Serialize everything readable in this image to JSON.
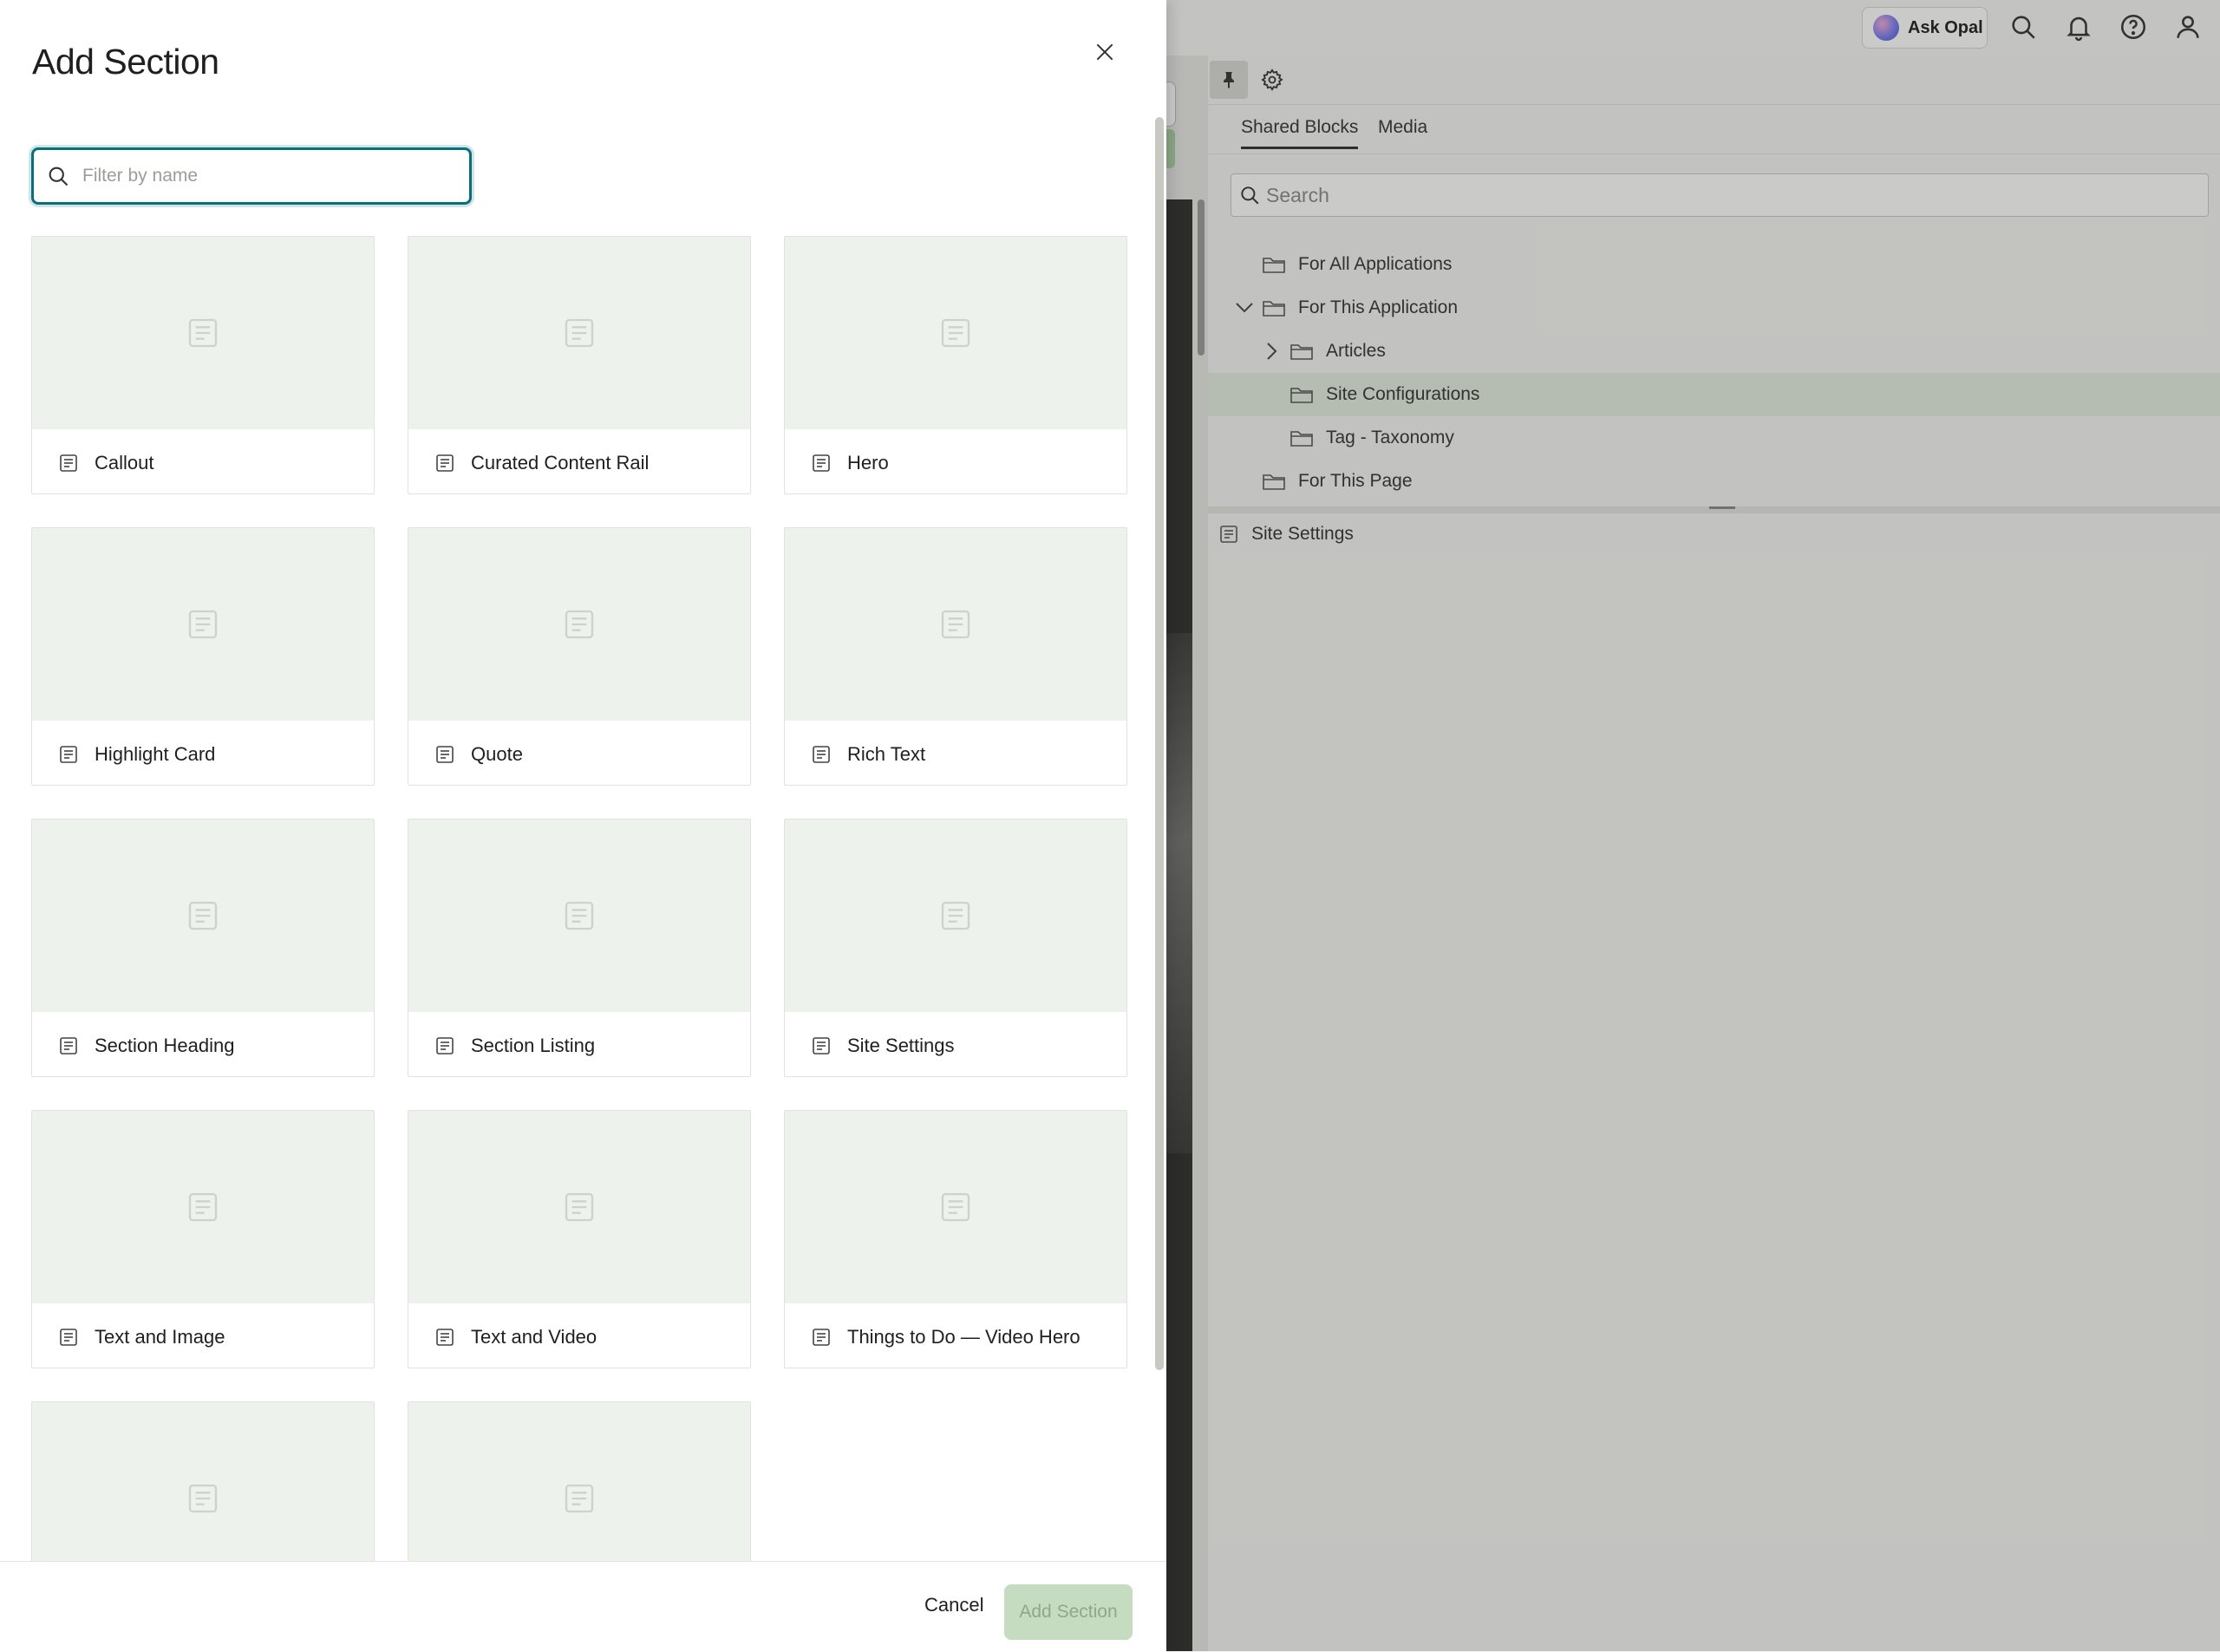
{
  "modal": {
    "title": "Add Section",
    "filter_placeholder": "Filter by name",
    "sections": [
      {
        "label": "Callout"
      },
      {
        "label": "Curated Content Rail"
      },
      {
        "label": "Hero"
      },
      {
        "label": "Highlight Card"
      },
      {
        "label": "Quote"
      },
      {
        "label": "Rich Text"
      },
      {
        "label": "Section Heading"
      },
      {
        "label": "Section Listing"
      },
      {
        "label": "Site Settings"
      },
      {
        "label": "Text and Image"
      },
      {
        "label": "Text and Video"
      },
      {
        "label": "Things to Do — Video Hero"
      },
      {
        "label": ""
      },
      {
        "label": ""
      }
    ],
    "cancel_label": "Cancel",
    "add_label": "Add Section"
  },
  "topbar": {
    "ask_opal": "Ask Opal"
  },
  "right_panel": {
    "tabs": [
      {
        "label": "Shared Blocks",
        "active": true
      },
      {
        "label": "Media",
        "active": false
      }
    ],
    "search_placeholder": "Search",
    "tree": [
      {
        "label": "For All Applications"
      },
      {
        "label": "For This Application",
        "expanded": true
      },
      {
        "label": "Articles",
        "collapsed": true
      },
      {
        "label": "Site Configurations",
        "selected": true
      },
      {
        "label": "Tag - Taxonomy"
      },
      {
        "label": "For This Page"
      }
    ],
    "list_items": [
      {
        "label": "Site Settings"
      }
    ]
  },
  "colors": {
    "focus_ring": "#0b6e78",
    "card_thumb": "#eef2ec",
    "add_button_disabled": "#c6dcc0",
    "selected_row": "#e3eee0"
  }
}
